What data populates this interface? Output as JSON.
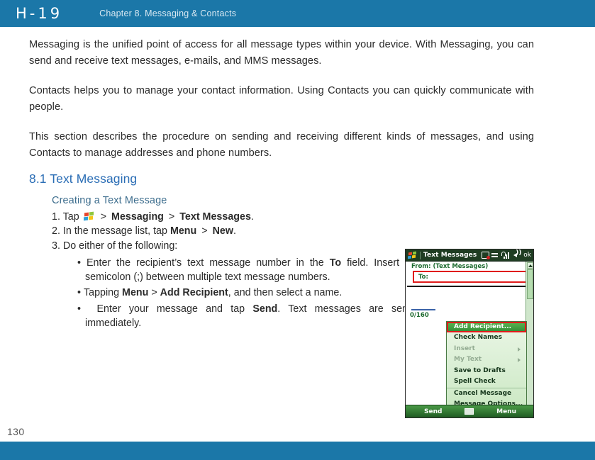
{
  "header": {
    "logo": "H-19",
    "chapter_title": "Chapter 8. Messaging & Contacts",
    "bg_color": "#1b77a8"
  },
  "footer": {
    "page_number": "130",
    "bg_color": "#1b77a8"
  },
  "content": {
    "paragraphs": [
      "Messaging is the unified point of access for all message types within your device. With Messaging, you can send and receive text messages, e-mails, and MMS messages.",
      "Contacts helps you to manage your contact information. Using Contacts you can quickly communicate with people.",
      "This section describes the procedure on sending and receiving different kinds of messages, and using Contacts to manage addresses and phone numbers."
    ],
    "section_heading": "8.1 Text Messaging",
    "section_heading_color": "#2a6db5",
    "sub_heading": "Creating a Text Message",
    "sub_heading_color": "#3e6e8e",
    "steps": {
      "step1": {
        "number": "1.",
        "verb": "Tap",
        "icon": "windows-start-flag-icon",
        "sep": ">",
        "target1": "Messaging",
        "target2": "Text Messages",
        "period": "."
      },
      "step2": {
        "number": "2.",
        "prefix": "In the message list, tap",
        "target1": "Menu",
        "sep": ">",
        "target2": "New",
        "period": "."
      },
      "step3": {
        "number": "3.",
        "text": "Do either of the following:"
      }
    },
    "bullets": [
      {
        "pre": "Enter the recipient’s text message number in the ",
        "bold": "To",
        "post": " field. Insert a semicolon (;) between  multiple text message numbers."
      },
      {
        "pre": "Tapping ",
        "bold": "Menu",
        "mid": " > ",
        "bold2": "Add Recipient",
        "post": ", and then select a name."
      },
      {
        "pre": " Enter your message and tap ",
        "bold": "Send",
        "post": ". Text messages are sent immediately."
      }
    ]
  },
  "pda": {
    "titlebar": {
      "start_icon": "windows-start-flag-icon",
      "title": "Text Messages",
      "icons": [
        "input-panel-icon",
        "connectivity-icon",
        "signal-strength-icon",
        "volume-icon"
      ],
      "ok_label": "ok"
    },
    "compose": {
      "from_label": "From: (Text Messages)",
      "to_label": "To:",
      "to_value": "",
      "char_count": "0/160",
      "highlight_color": "#e01b1b"
    },
    "menu": {
      "items": [
        {
          "label": "Add Recipient...",
          "selected": true,
          "disabled": false,
          "submenu": false,
          "separator_above": false
        },
        {
          "label": "Check Names",
          "selected": false,
          "disabled": false,
          "submenu": false,
          "separator_above": false
        },
        {
          "label": "Insert",
          "selected": false,
          "disabled": true,
          "submenu": true,
          "separator_above": false
        },
        {
          "label": "My Text",
          "selected": false,
          "disabled": true,
          "submenu": true,
          "separator_above": false
        },
        {
          "label": "Save to Drafts",
          "selected": false,
          "disabled": false,
          "submenu": false,
          "separator_above": false
        },
        {
          "label": "Spell Check",
          "selected": false,
          "disabled": false,
          "submenu": false,
          "separator_above": false
        },
        {
          "label": "Cancel Message",
          "selected": false,
          "disabled": false,
          "submenu": false,
          "separator_above": true
        },
        {
          "label": "Message Options...",
          "selected": false,
          "disabled": false,
          "submenu": false,
          "separator_above": false
        }
      ]
    },
    "bottombar": {
      "send_label": "Send",
      "keyboard_icon": "soft-keyboard-icon",
      "menu_label": "Menu"
    }
  }
}
